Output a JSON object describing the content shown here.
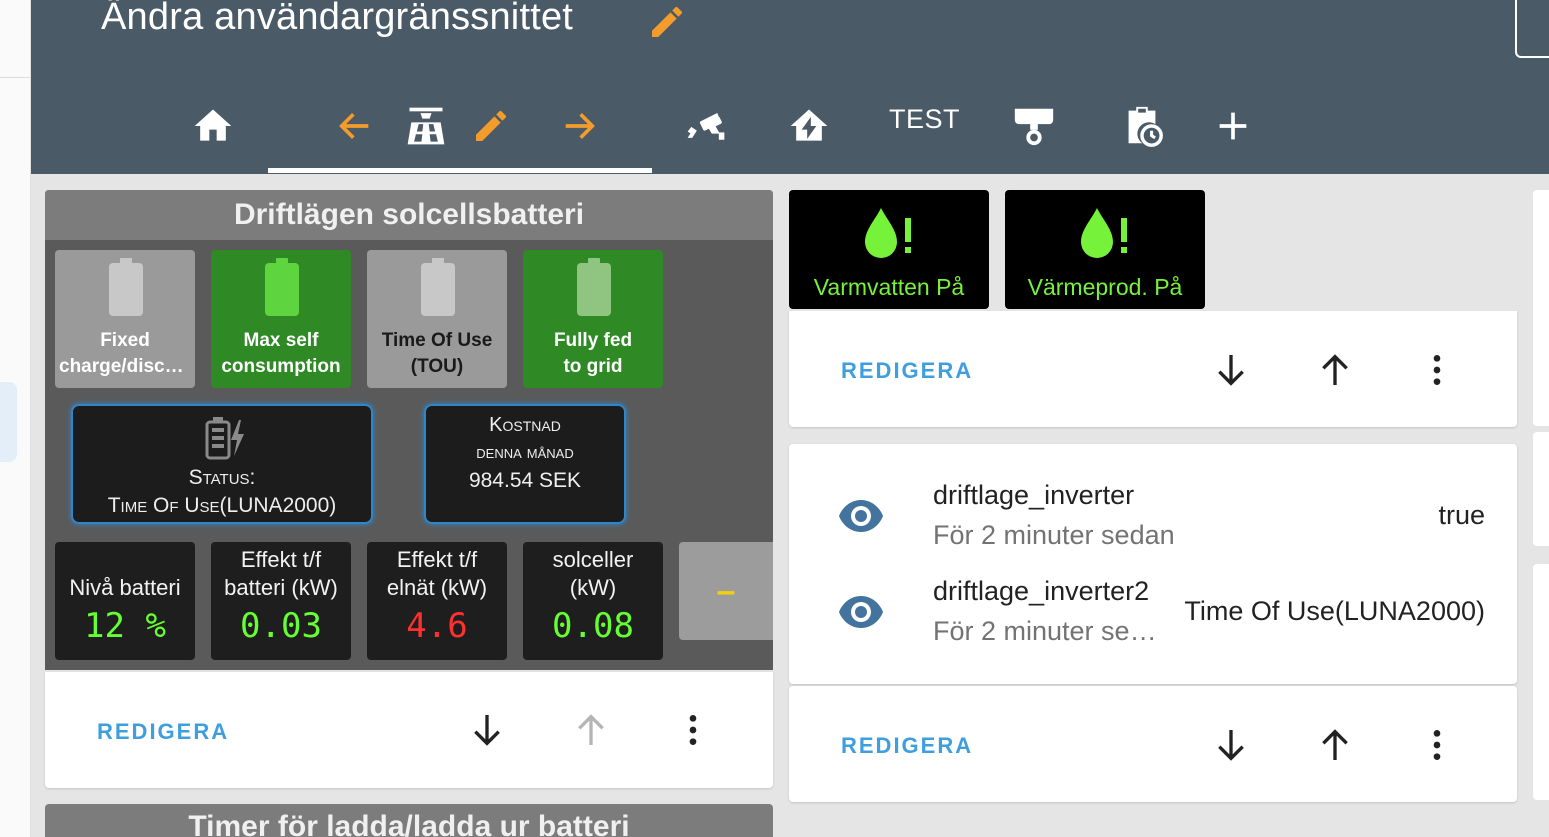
{
  "header": {
    "title": "Ändra användargränssnittet",
    "tabs": [
      {
        "name": "home-icon"
      },
      {
        "name": "arrow-left-icon"
      },
      {
        "name": "solar-panel-icon"
      },
      {
        "name": "pencil-icon"
      },
      {
        "name": "arrow-right-icon"
      },
      {
        "name": "cctv-icon"
      },
      {
        "name": "home-lightning-icon"
      },
      {
        "name": "tab-test",
        "label": "TEST"
      },
      {
        "name": "heat-pump-icon"
      },
      {
        "name": "clipboard-clock-icon"
      },
      {
        "name": "plus-icon"
      }
    ],
    "accent": "#f39c2c"
  },
  "battery_panel": {
    "title": "Driftlägen solcellsbatteri",
    "modes": [
      {
        "line1": "Fixed",
        "line2": "charge/disch…",
        "state": "off"
      },
      {
        "line1": "Max self",
        "line2": "consumption",
        "state": "on"
      },
      {
        "line1": "Time Of Use",
        "line2": "(TOU)",
        "state": "off"
      },
      {
        "line1": "Fully fed",
        "line2": "to grid",
        "state": "on-dim"
      }
    ],
    "status": {
      "line1": "Status:",
      "line2": "Time Of Use(LUNA2000)"
    },
    "cost": {
      "line1": "Kostnad",
      "line2": "denna månad",
      "value": "984.54 SEK"
    },
    "stats": [
      {
        "label1": "Nivå batteri",
        "label2": "",
        "value": "12 %",
        "color": "#66ff33"
      },
      {
        "label1": "Effekt t/f",
        "label2": "batteri (kW)",
        "value": "0.03",
        "color": "#66ff33"
      },
      {
        "label1": "Effekt t/f",
        "label2": "elnät (kW)",
        "value": "4.6",
        "color": "#ff3030"
      },
      {
        "label1": "solceller",
        "label2": "(kW)",
        "value": "0.08",
        "color": "#66ff33"
      }
    ],
    "collapse_label": "–"
  },
  "card_actions": {
    "edit_label": "REDIGERA"
  },
  "alerts": [
    {
      "label": "Varmvatten På"
    },
    {
      "label": "Värmeprod. På"
    }
  ],
  "entities": [
    {
      "name": "driftlage_inverter",
      "time": "För 2 minuter sedan",
      "value": "true"
    },
    {
      "name": "driftlage_inverter2",
      "time": "För 2 minuter se…",
      "value": "Time Of Use(LUNA2000)"
    }
  ],
  "next_panel": {
    "title": "Timer för ladda/ladda ur batteri"
  }
}
